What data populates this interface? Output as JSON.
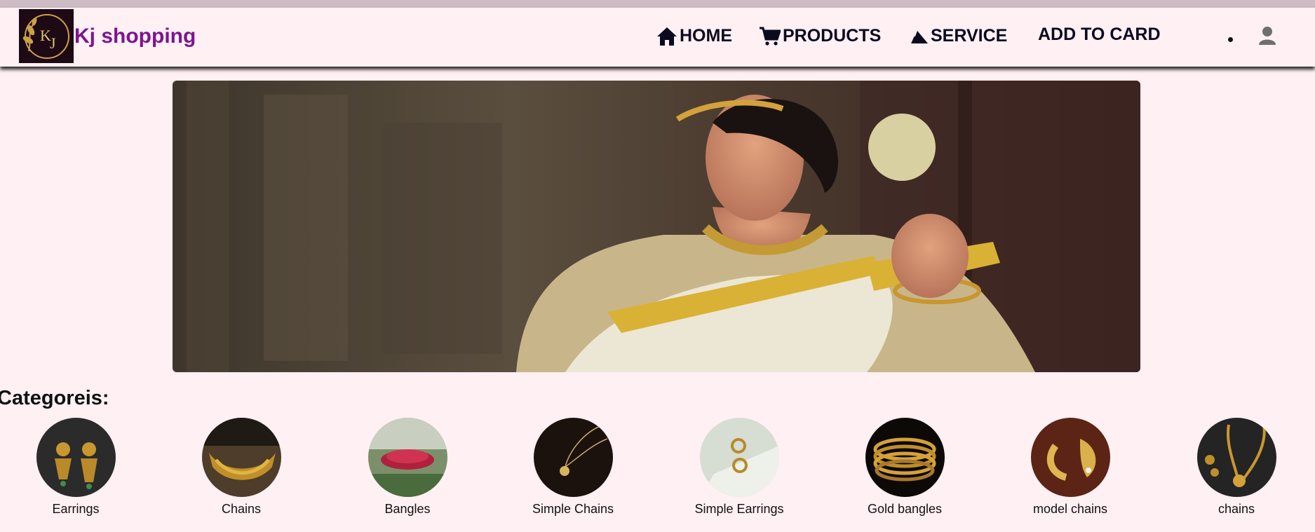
{
  "brand": {
    "name": "Kj shopping",
    "logo_text": "KJ"
  },
  "nav": {
    "home": "HOME",
    "products": "PRODUCTS",
    "service": "SERVICE",
    "cart": "ADD TO CARD"
  },
  "categories": {
    "title": "Categoreis:",
    "items": [
      {
        "label": "Earrings"
      },
      {
        "label": "Chains"
      },
      {
        "label": "Bangles"
      },
      {
        "label": "Simple Chains"
      },
      {
        "label": "Simple Earrings"
      },
      {
        "label": "Gold bangles"
      },
      {
        "label": "model chains"
      },
      {
        "label": "chains"
      }
    ]
  },
  "colors": {
    "brand": "#7d1590",
    "background": "#fff0f4",
    "nav_text": "#0b0b1e"
  },
  "icons": [
    "home-icon",
    "cart-icon",
    "service-icon",
    "user-icon"
  ]
}
